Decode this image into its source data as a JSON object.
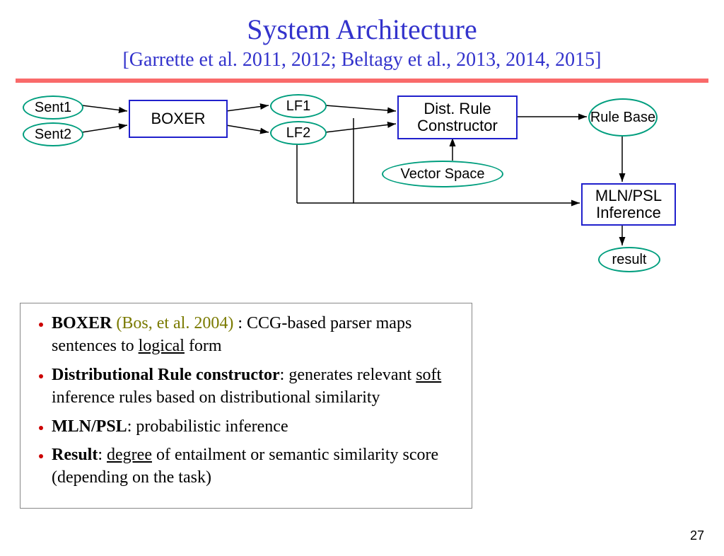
{
  "title": "System Architecture",
  "subtitle": "[Garrette et al. 2011, 2012; Beltagy et al., 2013, 2014, 2015]",
  "nodes": {
    "sent1": "Sent1",
    "sent2": "Sent2",
    "boxer": "BOXER",
    "lf1": "LF1",
    "lf2": "LF2",
    "dist_rule": "Dist. Rule Constructor",
    "vector_space": "Vector Space",
    "rule_base": "Rule Base",
    "mln_psl": "MLN/PSL Inference",
    "result": "result"
  },
  "bullets": {
    "b1_bold": "BOXER",
    "b1_cite": " (Bos, et al. 2004) ",
    "b1_rest1": ": CCG-based parser maps sentences to ",
    "b1_u": "logical",
    "b1_rest2": " form",
    "b2_bold": "Distributional Rule constructor",
    "b2_rest1": ": generates relevant ",
    "b2_u": "soft",
    "b2_rest2": " inference rules based on distributional similarity",
    "b3_bold": "MLN/PSL",
    "b3_rest": ": probabilistic inference",
    "b4_bold": "Result",
    "b4_rest1": ": ",
    "b4_u": "degree",
    "b4_rest2": " of entailment or semantic similarity score (depending on the task)"
  },
  "page": "27"
}
